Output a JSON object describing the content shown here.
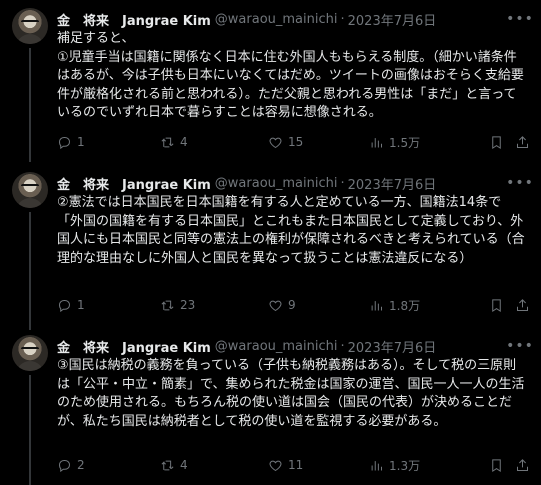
{
  "tweets": [
    {
      "name": "金　将来　Jangrae Kim",
      "handle": "@waraou_mainichi",
      "separator": "·",
      "date": "2023年7月6日",
      "text": "補足すると、\n①児童手当は国籍に関係なく日本に住む外国人ももらえる制度。（細かい諸条件はあるが、今は子供も日本にいなくてはだめ。ツイートの画像はおそらく支給要件が厳格化される前と思われる）。ただ父親と思われる男性は「まだ」と言っているのでいずれ日本で暮らすことは容易に想像される。",
      "replies": "1",
      "retweets": "4",
      "likes": "15",
      "views": "1.5万"
    },
    {
      "name": "金　将来　Jangrae Kim",
      "handle": "@waraou_mainichi",
      "separator": "·",
      "date": "2023年7月6日",
      "text": "②憲法では日本国民を日本国籍を有する人と定めている一方、国籍法14条で「外国の国籍を有する日本国民」とこれもまた日本国民として定義しており、外国人にも日本国民と同等の憲法上の権利が保障されるべきと考えられている（合理的な理由なしに外国人と国民を異なって扱うことは憲法違反になる）",
      "replies": "1",
      "retweets": "23",
      "likes": "9",
      "views": "1.8万"
    },
    {
      "name": "金　将来　Jangrae Kim",
      "handle": "@waraou_mainichi",
      "separator": "·",
      "date": "2023年7月6日",
      "text": "③国民は納税の義務を負っている（子供も納税義務はある）。そして税の三原則は「公平・中立・簡素」で、集められた税金は国家の運営、国民一人一人の生活のため使用される。もちろん税の使い道は国会（国民の代表）が決めることだが、私たち国民は納税者として税の使い道を監視する必要がある。",
      "replies": "2",
      "retweets": "4",
      "likes": "11",
      "views": "1.3万"
    }
  ],
  "icons": {
    "more": "more-dots-icon",
    "reply": "reply-icon",
    "retweet": "retweet-icon",
    "like": "heart-icon",
    "views": "views-chart-icon",
    "bookmark": "bookmark-icon",
    "share": "share-icon"
  },
  "colors": {
    "background": "#000000",
    "text": "#e7e9ea",
    "muted": "#71767b",
    "thread_line": "#333639"
  }
}
